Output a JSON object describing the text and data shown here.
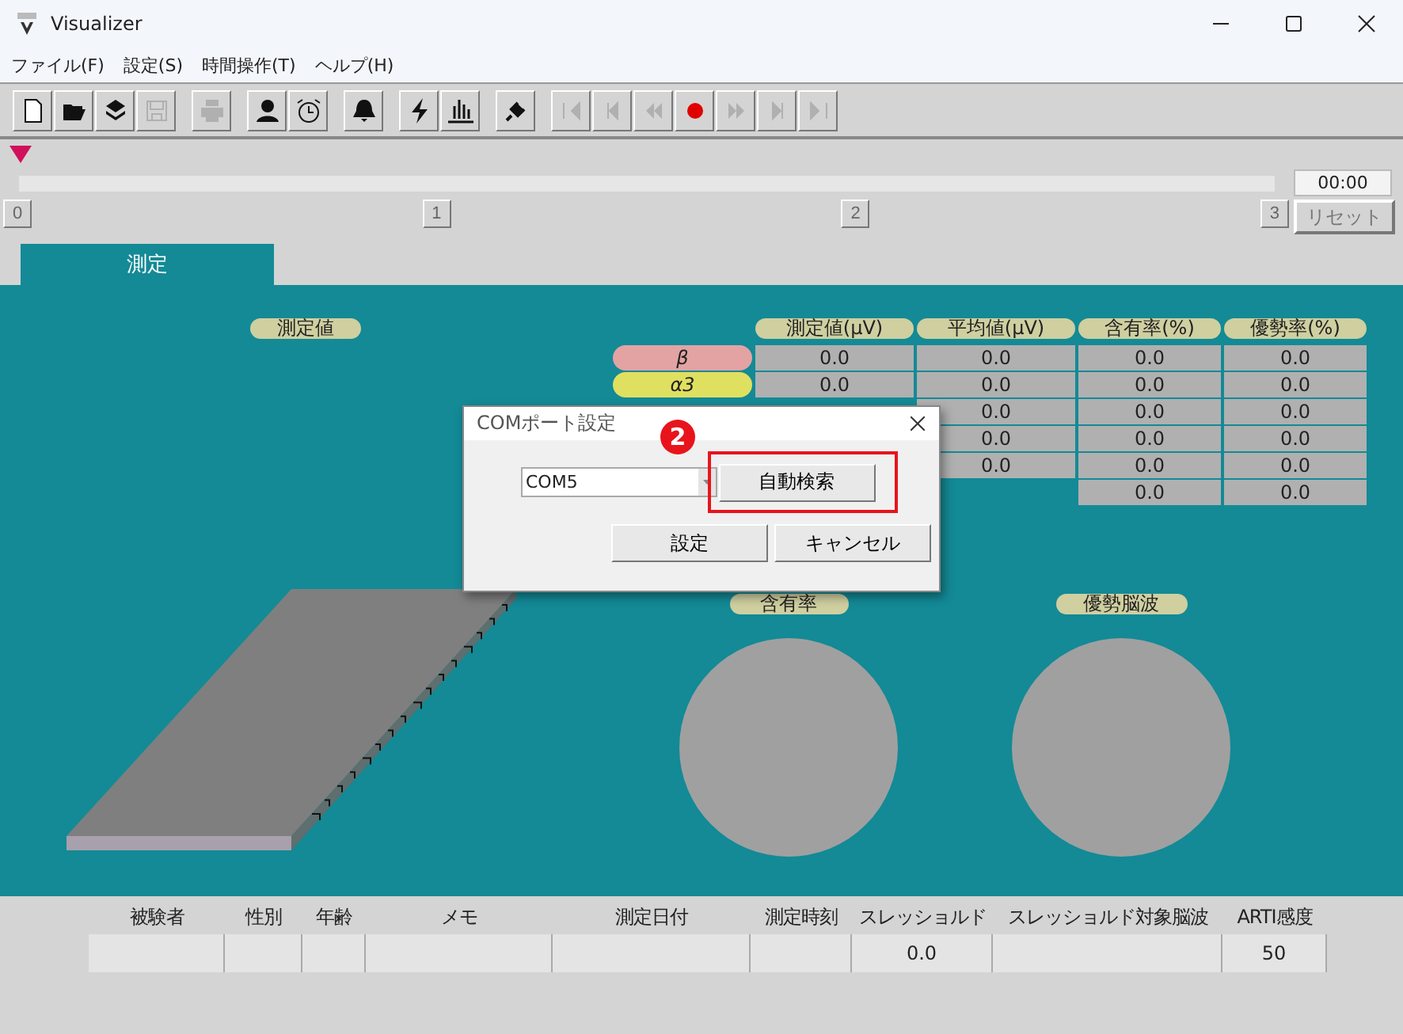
{
  "window": {
    "title": "Visualizer"
  },
  "menu": [
    "ファイル(F)",
    "設定(S)",
    "時間操作(T)",
    "ヘルプ(H)"
  ],
  "toolbar": [
    [
      {
        "kind": "new",
        "disabled": false
      },
      {
        "kind": "open",
        "disabled": false
      },
      {
        "kind": "layers",
        "disabled": false
      },
      {
        "kind": "save",
        "disabled": true
      }
    ],
    [
      {
        "kind": "print",
        "disabled": true
      }
    ],
    [
      {
        "kind": "person",
        "disabled": false
      },
      {
        "kind": "alarm",
        "disabled": false
      }
    ],
    [
      {
        "kind": "bell",
        "disabled": false
      }
    ],
    [
      {
        "kind": "bolt",
        "disabled": false
      },
      {
        "kind": "chart",
        "disabled": false
      }
    ],
    [
      {
        "kind": "plug",
        "disabled": false
      }
    ],
    [
      {
        "kind": "first",
        "disabled": true
      },
      {
        "kind": "prev",
        "disabled": true
      },
      {
        "kind": "rewind",
        "disabled": true
      },
      {
        "kind": "record",
        "disabled": false
      },
      {
        "kind": "forward",
        "disabled": true
      },
      {
        "kind": "next",
        "disabled": true
      },
      {
        "kind": "last",
        "disabled": true
      }
    ]
  ],
  "timeline": {
    "marks": [
      "0",
      "1",
      "2",
      "3"
    ],
    "time": "00:00",
    "reset": {
      "label": "リセット",
      "disabled": true
    }
  },
  "tabs": [
    {
      "label": "測定",
      "selected": true
    }
  ],
  "panel": {
    "value_label": "測定値",
    "columns": [
      "測定値(μV)",
      "平均値(μV)",
      "含有率(%)",
      "優勢率(%)"
    ],
    "rows": [
      {
        "band": "β",
        "color": "#e3a3a3",
        "values": [
          "0.0",
          "0.0",
          "0.0",
          "0.0"
        ]
      },
      {
        "band": "α3",
        "color": "#e0e060",
        "values": [
          "0.0",
          "0.0",
          "0.0",
          "0.0"
        ]
      },
      {
        "values": [
          "0.0",
          "0.0",
          "0.0"
        ]
      },
      {
        "values": [
          "0.0",
          "0.0",
          "0.0"
        ]
      },
      {
        "values": [
          "0.0",
          "0.0",
          "0.0"
        ]
      },
      {
        "values": [
          "0.0",
          "0.0"
        ]
      }
    ],
    "gauges": [
      {
        "label": "含有率"
      },
      {
        "label": "優勢脳波"
      }
    ]
  },
  "dialog": {
    "title": "COMポート設定",
    "port": "COM5",
    "search_button": "自動検索",
    "step": "2",
    "buttons": [
      "設定",
      "キャンセル"
    ]
  },
  "subject_table": {
    "columns": [
      {
        "label": "被験者"
      },
      {
        "label": "性別"
      },
      {
        "label": "年齢"
      },
      {
        "label": "メモ"
      },
      {
        "label": "測定日付"
      },
      {
        "label": "測定時刻"
      },
      {
        "label": "スレッショルド",
        "value": "0.0"
      },
      {
        "label": "スレッショルド対象脳波"
      },
      {
        "label": "ARTI感度",
        "value": "50"
      }
    ]
  }
}
